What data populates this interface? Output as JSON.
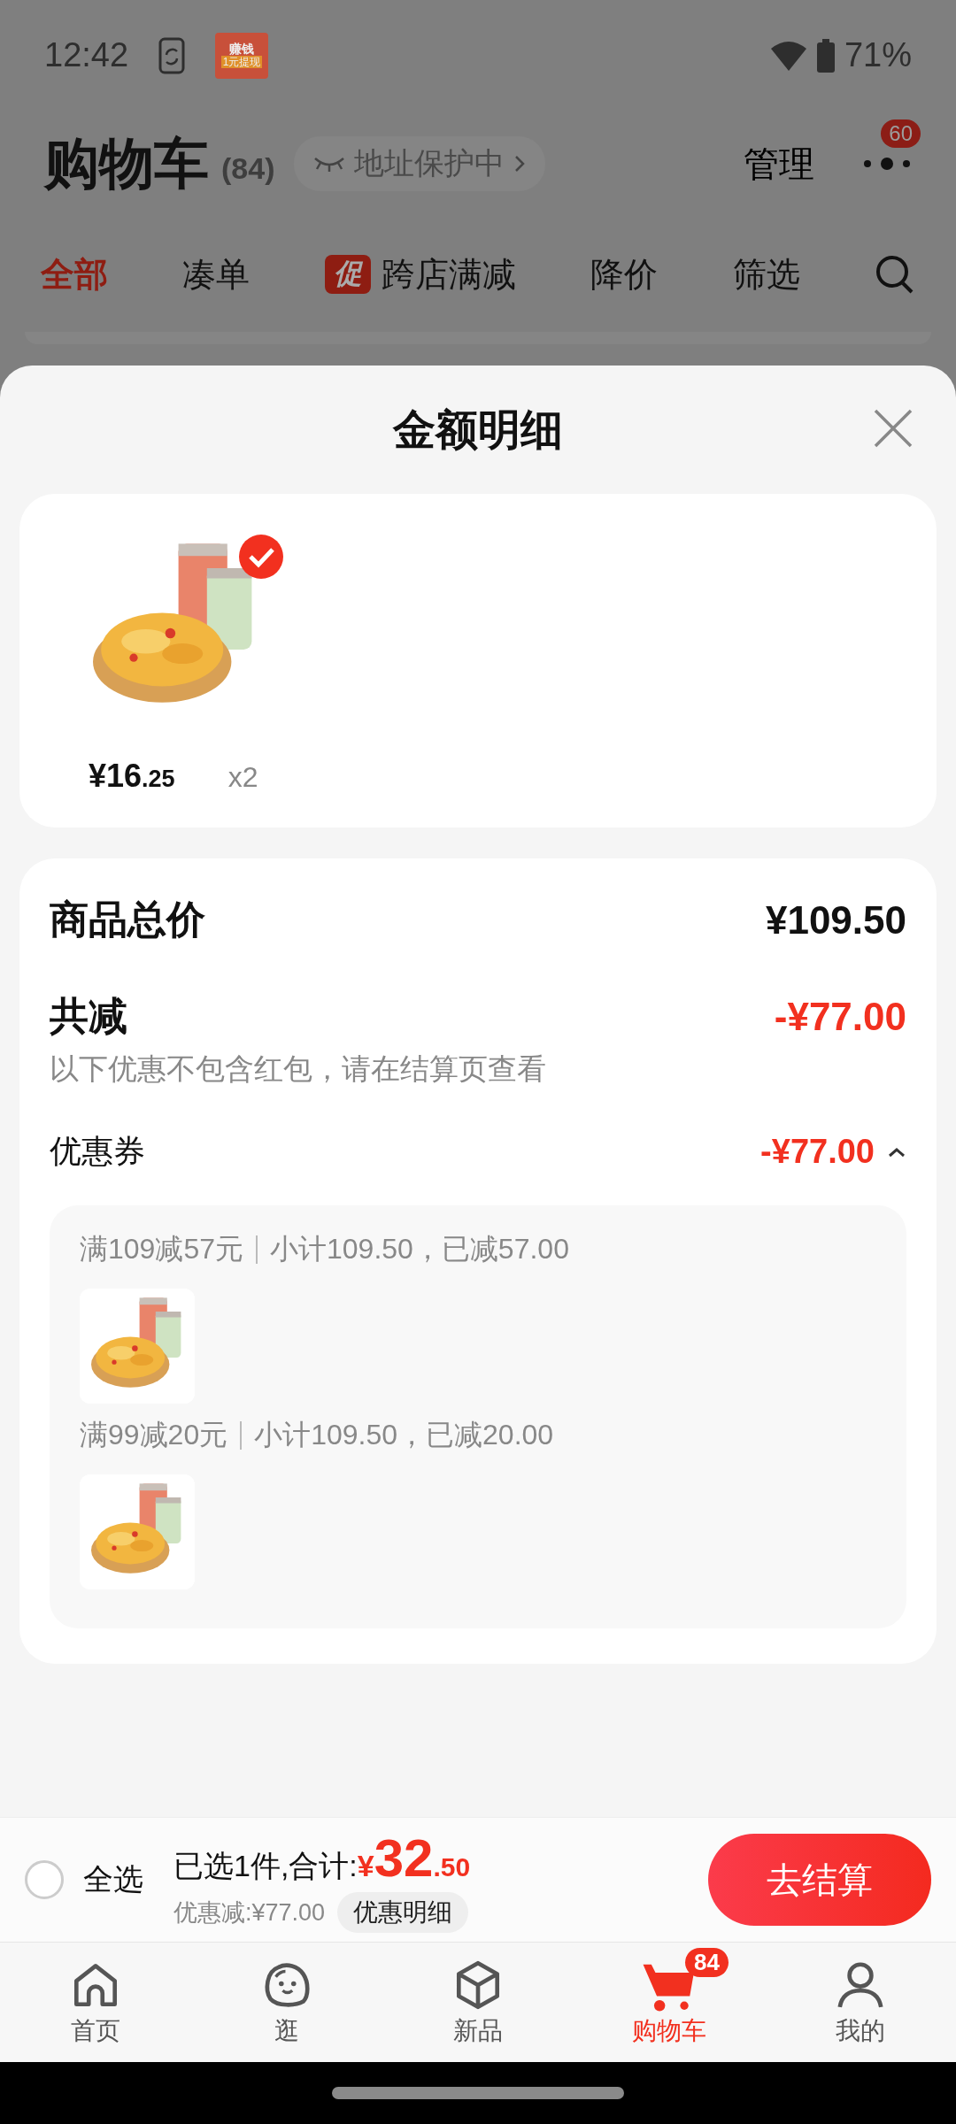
{
  "status_bar": {
    "time": "12:42",
    "app_badge": "赚钱",
    "app_badge_sub": "1元提现",
    "battery": "71%"
  },
  "header": {
    "title": "购物车",
    "count": "(84)",
    "address_chip": "地址保护中",
    "manage": "管理",
    "more_badge": "60"
  },
  "tabs": [
    {
      "label": "全部",
      "selected": true
    },
    {
      "label": "凑单",
      "selected": false
    },
    {
      "label": "跨店满减",
      "selected": false,
      "tag": "促"
    },
    {
      "label": "降价",
      "selected": false
    },
    {
      "label": "筛选",
      "selected": false
    }
  ],
  "sheet": {
    "title": "金额明细",
    "product": {
      "price": "¥16",
      "price_decimal": ".25",
      "quantity": "x2"
    },
    "total": {
      "label": "商品总价",
      "value": "¥109.50"
    },
    "reduction": {
      "label": "共减",
      "value": "-¥77.00",
      "note": "以下优惠不包含红包，请在结算页查看"
    },
    "coupon": {
      "label": "优惠券",
      "value": "-¥77.00",
      "expanded": true,
      "groups": [
        {
          "rule": "满109减57元",
          "detail": "小计109.50，已减57.00"
        },
        {
          "rule": "满99减20元",
          "detail": "小计109.50，已减20.00"
        }
      ]
    }
  },
  "checkout_bar": {
    "select_all": {
      "label": "全选",
      "checked": false
    },
    "selected_text": "已选1件,合计:",
    "currency": "¥",
    "total": "32",
    "total_decimal": ".50",
    "discount": "优惠减:¥77.00",
    "detail_button": "优惠明细",
    "checkout_button": "去结算"
  },
  "nav": [
    {
      "label": "首页",
      "kind": "home",
      "selected": false
    },
    {
      "label": "逛",
      "kind": "browse",
      "selected": false
    },
    {
      "label": "新品",
      "kind": "new",
      "selected": false
    },
    {
      "label": "购物车",
      "kind": "cart",
      "selected": true,
      "badge": "84"
    },
    {
      "label": "我的",
      "kind": "me",
      "selected": false
    }
  ]
}
